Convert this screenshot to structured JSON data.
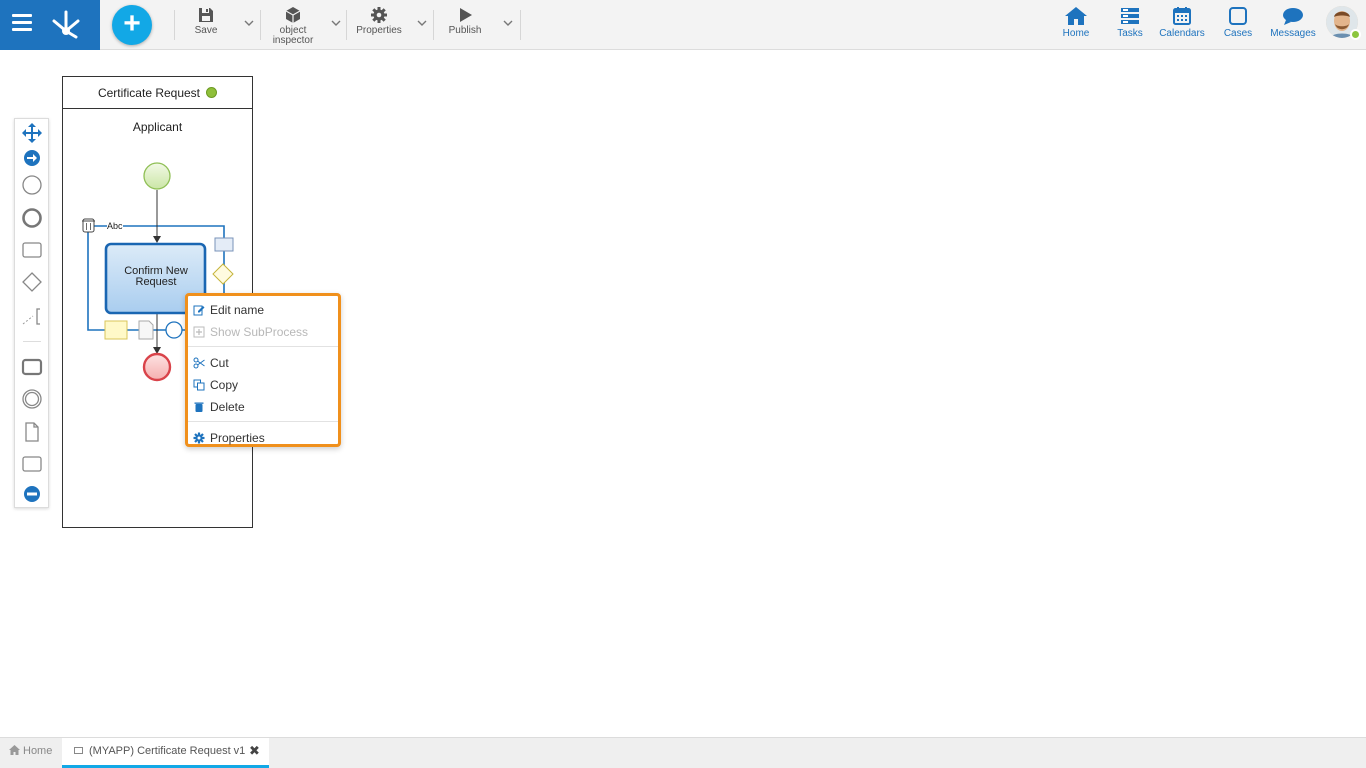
{
  "toolbar": {
    "save_label": "Save",
    "inspector_label_line1": "object",
    "inspector_label_line2": "inspector",
    "properties_label": "Properties",
    "publish_label": "Publish",
    "add_label": "+"
  },
  "nav": {
    "home": "Home",
    "tasks": "Tasks",
    "calendars": "Calendars",
    "cases": "Cases",
    "messages": "Messages"
  },
  "diagram": {
    "pool_title": "Certificate Request",
    "lane_title": "Applicant",
    "task_line1": "Confirm New",
    "task_line2": "Request",
    "text_tool_label": "Abc"
  },
  "context_menu": {
    "edit_name": "Edit name",
    "show_subprocess": "Show SubProcess",
    "cut": "Cut",
    "copy": "Copy",
    "delete": "Delete",
    "properties": "Properties"
  },
  "tabs": {
    "home": "Home",
    "document": "(MYAPP) Certificate Request v1",
    "close": "✖"
  },
  "colors": {
    "brand_blue": "#1e73be",
    "accent_cyan": "#12a8e6",
    "menu_highlight": "#f0901c",
    "status_green": "#8fbf3a"
  }
}
